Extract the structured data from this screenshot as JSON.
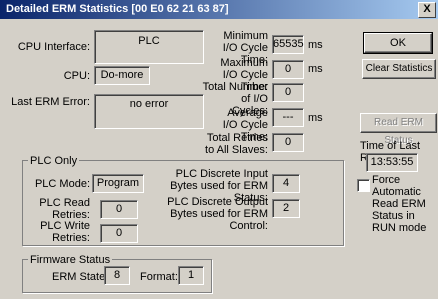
{
  "window": {
    "title": "Detailed ERM Statistics [00 E0 62 21 63 87]",
    "close_label": "X"
  },
  "cpu_interface": {
    "label": "CPU Interface:",
    "value": "PLC"
  },
  "cpu": {
    "label": "CPU:",
    "value": "Do-more"
  },
  "last_erm_error": {
    "label": "Last ERM Error:",
    "value": "no error"
  },
  "min_io_cycle": {
    "label": "Minimum I/O Cycle Time:",
    "value": "65535",
    "unit": "ms"
  },
  "max_io_cycle": {
    "label": "Maximum I/O Cycle Time:",
    "value": "0",
    "unit": "ms"
  },
  "total_io_cycles": {
    "label": "Total Number of I/O Cycles:",
    "value": "0"
  },
  "avg_io_cycle": {
    "label": "Average I/O Cycle Time:",
    "value": "---",
    "unit": "ms"
  },
  "total_retries": {
    "label": "Total Retries to All Slaves:",
    "value": "0"
  },
  "buttons": {
    "ok": "OK",
    "clear": "Clear Statistics",
    "read_status": "Read ERM Status"
  },
  "last_read": {
    "label": "Time of Last Read:",
    "value": "13:53:55"
  },
  "force_auto": {
    "label": "Force Automatic Read ERM Status in RUN mode",
    "checked": false
  },
  "plc_only": {
    "title": "PLC Only",
    "mode": {
      "label": "PLC Mode:",
      "value": "Program"
    },
    "read_retries": {
      "label": "PLC Read Retries:",
      "value": "0"
    },
    "write_retries": {
      "label": "PLC Write Retries:",
      "value": "0"
    },
    "discrete_input": {
      "label": "PLC Discrete Input Bytes used for ERM Status:",
      "value": "4"
    },
    "discrete_output": {
      "label": "PLC Discrete Output Bytes used for ERM Control:",
      "value": "2"
    }
  },
  "firmware": {
    "title": "Firmware Status",
    "erm_state": {
      "label": "ERM State:",
      "value": "8"
    },
    "format": {
      "label": "Format:",
      "value": "1"
    }
  }
}
